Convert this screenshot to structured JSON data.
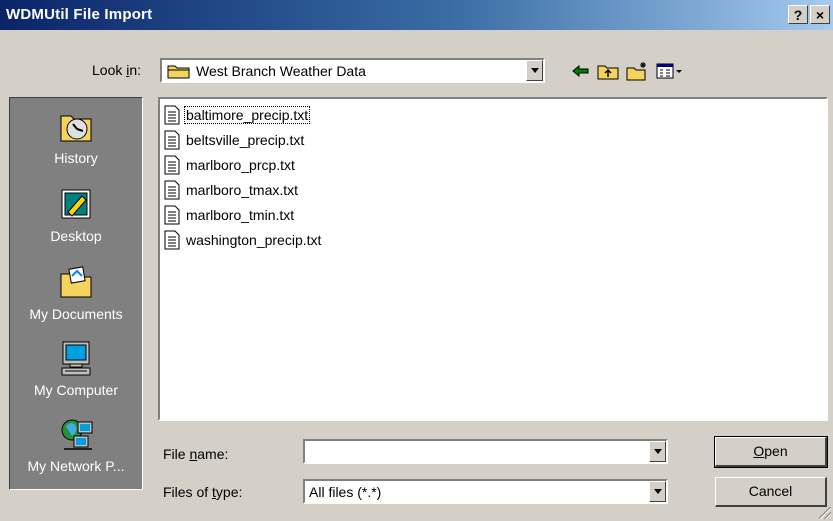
{
  "window": {
    "title": "WDMUtil File Import",
    "help_label": "?",
    "close_label": "×"
  },
  "lookin": {
    "label_pre": "Look ",
    "label_accel": "i",
    "label_post": "n:",
    "value": "West Branch Weather Data",
    "folder_icon": "folder-icon"
  },
  "toolbar": {
    "icons": [
      "back-arrow-icon",
      "up-folder-icon",
      "new-folder-icon",
      "view-menu-icon"
    ]
  },
  "places": [
    {
      "label": "History",
      "icon": "history-icon"
    },
    {
      "label": "Desktop",
      "icon": "desktop-icon"
    },
    {
      "label": "My Documents",
      "icon": "my-documents-icon"
    },
    {
      "label": "My Computer",
      "icon": "my-computer-icon"
    },
    {
      "label": "My Network P...",
      "icon": "network-places-icon"
    }
  ],
  "files": [
    {
      "name": "baltimore_precip.txt"
    },
    {
      "name": "beltsville_precip.txt"
    },
    {
      "name": "marlboro_prcp.txt"
    },
    {
      "name": "marlboro_tmax.txt"
    },
    {
      "name": "marlboro_tmin.txt"
    },
    {
      "name": "washington_precip.txt"
    }
  ],
  "filename": {
    "label_pre": "File ",
    "label_accel": "n",
    "label_post": "ame:",
    "value": ""
  },
  "filetype": {
    "label_pre": "Files of ",
    "label_accel": "t",
    "label_post": "ype:",
    "value": "All files (*.*)"
  },
  "buttons": {
    "open_accel": "O",
    "open_rest": "pen",
    "cancel": "Cancel"
  }
}
